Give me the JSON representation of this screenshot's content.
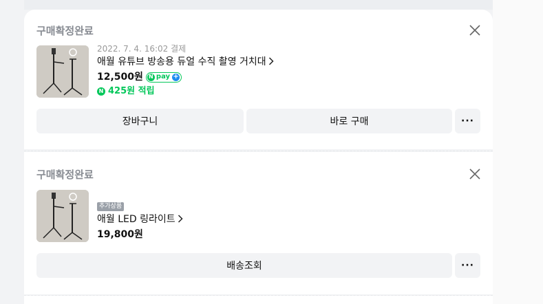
{
  "orders": [
    {
      "status": "구매확정완료",
      "date": "2022. 7. 4. 16:02 결제",
      "title": "애월 유튜브 방송용 듀얼 수직 촬영 거치대",
      "price": "12,500원",
      "npay_label": "pay",
      "points": "425원 적립",
      "buttons": [
        "장바구니",
        "바로 구매"
      ],
      "more": "···"
    },
    {
      "status": "구매확정완료",
      "badge": "추가상품",
      "title": "애월 LED 링라이트",
      "price": "19,800원",
      "buttons": [
        "배송조회"
      ],
      "more": "···"
    }
  ],
  "colors": {
    "accent": "#03c75a",
    "npay_plus": "#1e8cf0",
    "button_bg": "#f2f3f5",
    "status_gray": "#888c93"
  },
  "icons": [
    "close-icon",
    "chevron-right-icon",
    "naver-pay-icon",
    "more-icon"
  ]
}
